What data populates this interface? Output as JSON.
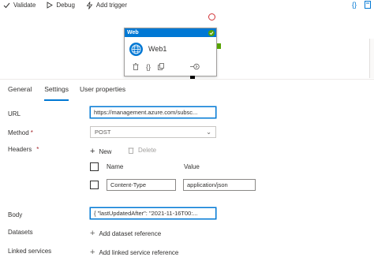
{
  "toolbar": {
    "validate_label": "Validate",
    "debug_label": "Debug",
    "add_trigger_label": "Add trigger",
    "code_icon_text": "{}"
  },
  "activity": {
    "type_label": "Web",
    "name": "Web1",
    "code_glyph": "{}",
    "go_glyph": "(+)"
  },
  "tabs": {
    "general": "General",
    "settings": "Settings",
    "user_properties": "User properties"
  },
  "form": {
    "url_label": "URL",
    "url_value": "https://management.azure.com/subsc...",
    "method_label": "Method",
    "method_value": "POST",
    "headers_label": "Headers",
    "new_label": "New",
    "delete_label": "Delete",
    "col_name": "Name",
    "col_value": "Value",
    "header_name": "Content-Type",
    "header_value": "application/json",
    "body_label": "Body",
    "body_value": "{ \"lastUpdatedAfter\": \"2021-11-16T00:...",
    "datasets_label": "Datasets",
    "add_dataset_label": "Add dataset reference",
    "linked_services_label": "Linked services",
    "add_linked_label": "Add linked service reference"
  },
  "colors": {
    "accent": "#0078d4",
    "success": "#57a300",
    "fail": "#d13438"
  }
}
